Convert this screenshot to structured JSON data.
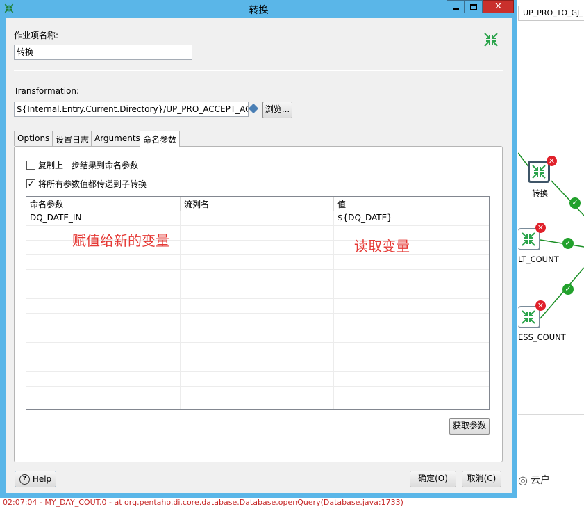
{
  "window": {
    "title": "转换"
  },
  "form": {
    "job_entry_name_label": "作业项名称:",
    "job_entry_name_value": "转换",
    "transformation_label": "Transformation:",
    "transformation_value": "${Internal.Entry.Current.Directory}/UP_PRO_ACCEPT_ACC.k",
    "browse_label": "浏览..."
  },
  "tabs": [
    {
      "label": "Options"
    },
    {
      "label": "设置日志"
    },
    {
      "label": "Arguments"
    },
    {
      "label": "命名参数"
    }
  ],
  "params_tab": {
    "copy_results_label": "复制上一步结果到命名参数",
    "copy_results_checked": false,
    "pass_all_label": "将所有参数值都传递到子转换",
    "pass_all_checked": true,
    "columns": [
      "命名参数",
      "流列名",
      "值"
    ],
    "rows": [
      [
        "DQ_DATE_IN",
        "",
        "${DQ_DATE}"
      ]
    ],
    "get_params_label": "获取参数"
  },
  "annotations": {
    "left": "赋值给新的变量",
    "right": "读取变量"
  },
  "footer": {
    "help_label": "Help",
    "ok_label": "确定(O)",
    "cancel_label": "取消(C)"
  },
  "background": {
    "tab_label": "UP_PRO_TO_GJ_",
    "node_labels": [
      "转换",
      "LT_COUNT",
      "ESS_COUNT"
    ],
    "log_line": "02:07:04 - MY_DAY_COUT.0 -     at org.pentaho.di.core.database.Database.openQuery(Database.java:1733)",
    "watermark": "云户"
  },
  "colors": {
    "titlebar": "#5ab6e8",
    "annotation": "#e53935",
    "ok_hop": "#22a12c",
    "error_badge": "#e0202a"
  }
}
